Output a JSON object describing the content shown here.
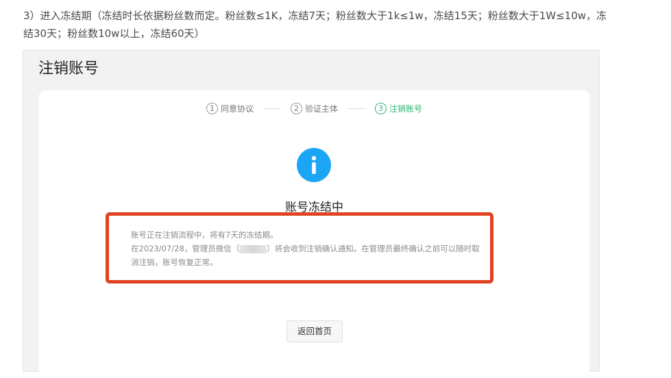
{
  "intro": {
    "text": "3）进入冻结期（冻结时长依据粉丝数而定。粉丝数≤1K，冻结7天；粉丝数大于1k≤1w，冻结15天；粉丝数大于1W≤10w，冻结30天；粉丝数10w以上，冻结60天）"
  },
  "page": {
    "title": "注销账号"
  },
  "steps": [
    {
      "num": "1",
      "label": "同意协议",
      "active": false
    },
    {
      "num": "2",
      "label": "验证主体",
      "active": false
    },
    {
      "num": "3",
      "label": "注销账号",
      "active": true
    }
  ],
  "status": {
    "icon": "info-icon",
    "title": "账号冻结中",
    "line1": "账号正在注销流程中，将有7天的冻结期。",
    "line2_before": "在2023/07/28，管理员微信（",
    "line2_after": "）将会收到注销确认通知。在管理员最终确认之前可以随时取消注销，账号恢复正常。"
  },
  "actions": {
    "back_label": "返回首页"
  },
  "colors": {
    "accent": "#2bb673",
    "info": "#1aa6f5",
    "highlight": "#e04222"
  }
}
